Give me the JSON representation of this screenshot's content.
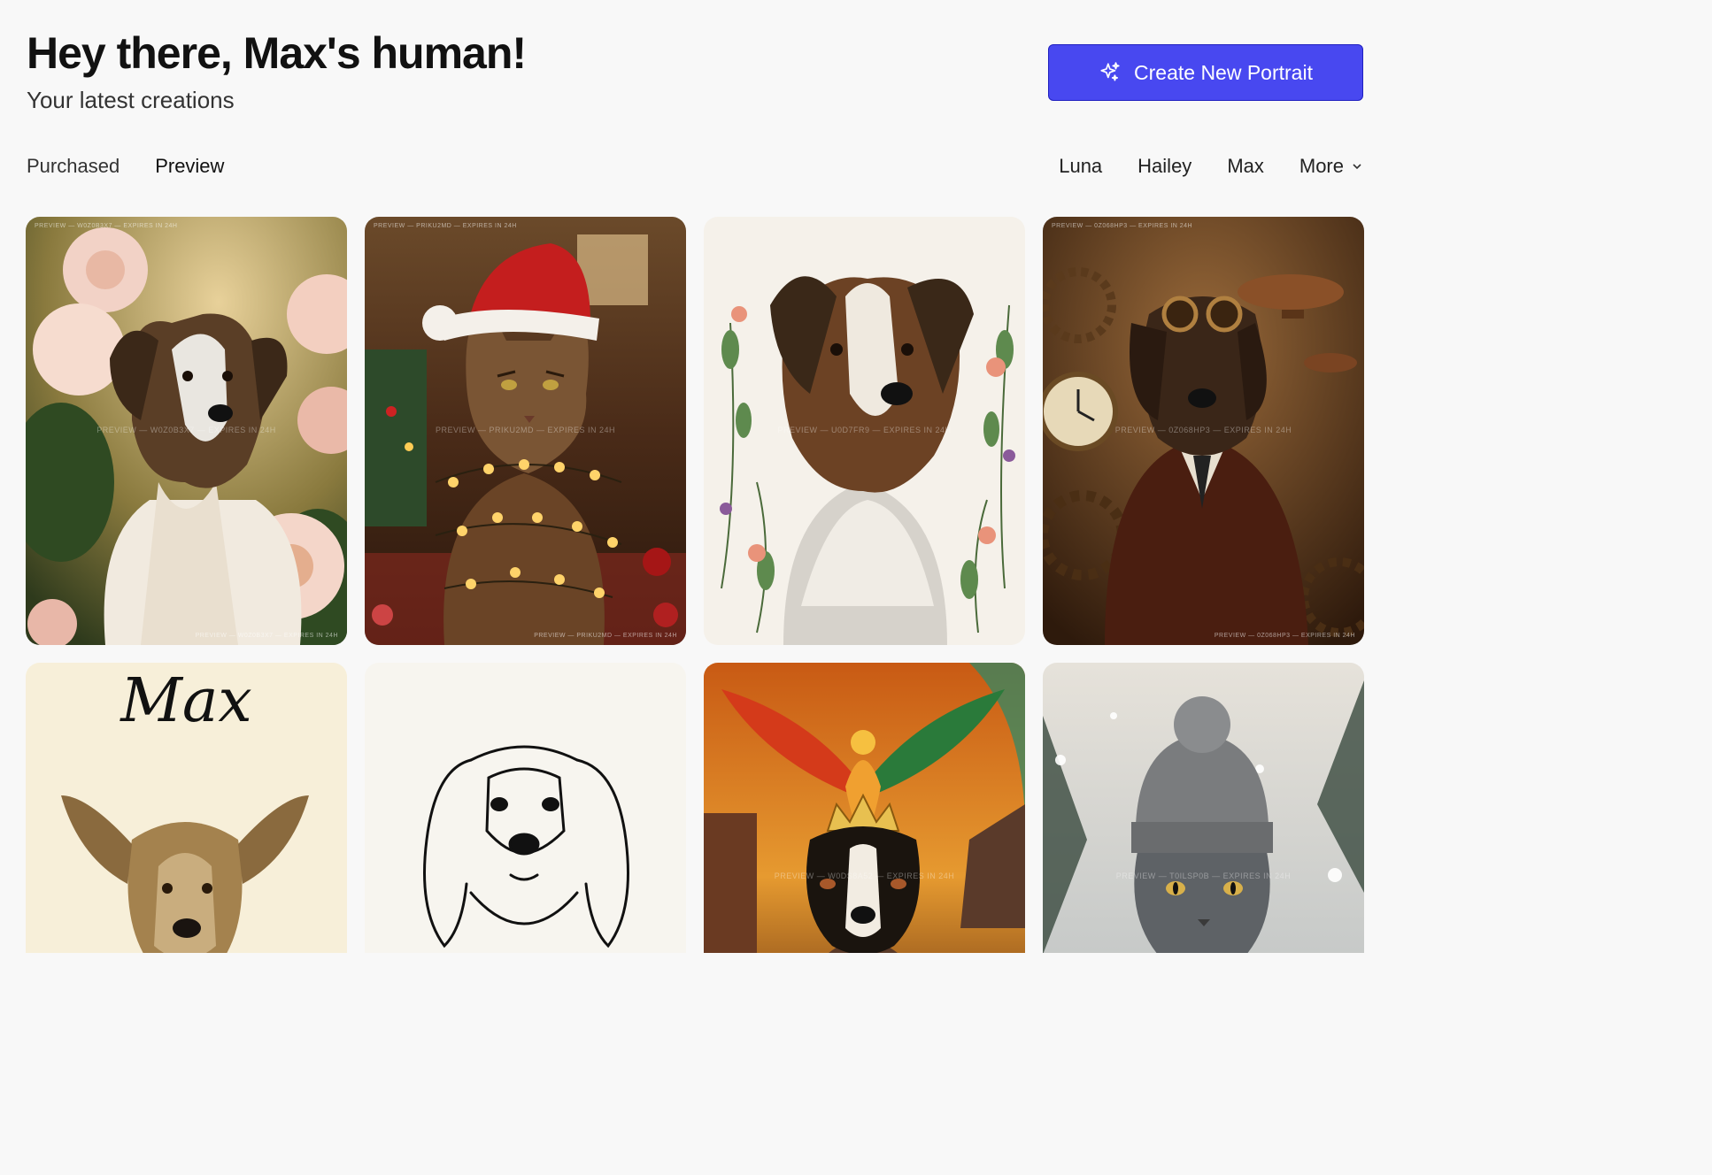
{
  "header": {
    "title": "Hey there, Max's human!",
    "subtitle": "Your latest creations"
  },
  "create_button": {
    "label": "Create New Portrait",
    "icon": "sparkles-icon",
    "color": "#4848f0"
  },
  "tabs": [
    {
      "label": "Purchased",
      "active": false
    },
    {
      "label": "Preview",
      "active": true
    }
  ],
  "filters": [
    {
      "label": "Luna"
    },
    {
      "label": "Hailey"
    },
    {
      "label": "Max"
    },
    {
      "label": "More",
      "icon": "chevron-down-icon"
    }
  ],
  "portraits": [
    {
      "subject": "dog",
      "theme": "peonies",
      "watermark_top": "PREVIEW — W0Z0B3X7 — EXPIRES IN 24H",
      "watermark_mid": "PREVIEW — W0Z0B3X7 — EXPIRES IN 24H",
      "watermark_bot": "PREVIEW — W0Z0B3X7 — EXPIRES IN 24H"
    },
    {
      "subject": "cat",
      "theme": "christmas",
      "watermark_top": "PREVIEW — PRIKU2MD — EXPIRES IN 24H",
      "watermark_mid": "PREVIEW — PRIKU2MD — EXPIRES IN 24H",
      "watermark_bot": "PREVIEW — PRIKU2MD — EXPIRES IN 24H"
    },
    {
      "subject": "dog",
      "theme": "watercolor floral",
      "watermark_top": "",
      "watermark_mid": "PREVIEW — U0D7FR9 — EXPIRES IN 24H",
      "watermark_bot": ""
    },
    {
      "subject": "dog",
      "theme": "steampunk aviator",
      "watermark_top": "PREVIEW — 0Z068HP3 — EXPIRES IN 24H",
      "watermark_mid": "PREVIEW — 0Z068HP3 — EXPIRES IN 24H",
      "watermark_bot": "PREVIEW — 0Z068HP3 — EXPIRES IN 24H"
    },
    {
      "subject": "dog",
      "theme": "vintage name",
      "name_text": "Max",
      "watermark_top": "",
      "watermark_mid": "",
      "watermark_bot": ""
    },
    {
      "subject": "dog",
      "theme": "line art",
      "watermark_top": "",
      "watermark_mid": "",
      "watermark_bot": ""
    },
    {
      "subject": "dog",
      "theme": "phoenix king",
      "watermark_top": "",
      "watermark_mid": "PREVIEW — W0DS8A52 — EXPIRES IN 24H",
      "watermark_bot": ""
    },
    {
      "subject": "cat",
      "theme": "winter beanie",
      "watermark_top": "",
      "watermark_mid": "PREVIEW — T0ILSP0B — EXPIRES IN 24H",
      "watermark_bot": ""
    }
  ]
}
